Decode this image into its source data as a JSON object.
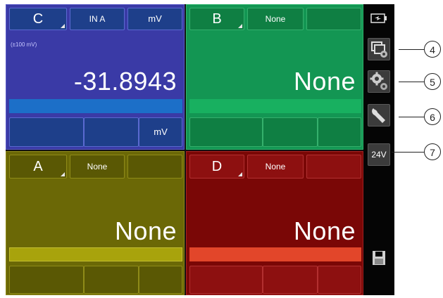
{
  "panels": {
    "C": {
      "channel": "C",
      "function": "IN A",
      "unit": "mV",
      "range": "(±100 mV)",
      "reading": "-31.8943",
      "bottom_unit": "mV",
      "colors": {
        "bg": "#3a3aa6",
        "btn": "#1e3f8a",
        "btn_border": "#5a6ad0",
        "bar": "#1c6fc8"
      }
    },
    "B": {
      "channel": "B",
      "function": "None",
      "reading": "None",
      "colors": {
        "bg": "#139653",
        "btn": "#0f7f43",
        "btn_border": "#35b06c",
        "bar": "#18b060"
      }
    },
    "A": {
      "channel": "A",
      "function": "None",
      "reading": "None",
      "colors": {
        "bg": "#6b6806",
        "btn": "#5a5804",
        "btn_border": "#8f8b18",
        "bar": "#a8a30c"
      }
    },
    "D": {
      "channel": "D",
      "function": "None",
      "reading": "None",
      "colors": {
        "bg": "#7a0706",
        "btn": "#8d1010",
        "btn_border": "#b23030",
        "bar": "#e2462a"
      }
    }
  },
  "sidebar": {
    "battery_icon": "battery-charging-icon",
    "buttons": [
      {
        "icon": "windows-settings-icon"
      },
      {
        "icon": "gears-icon"
      },
      {
        "icon": "wrench-icon"
      },
      {
        "label": "24V"
      }
    ],
    "save_icon": "save-icon"
  },
  "callouts": [
    "4",
    "5",
    "6",
    "7"
  ]
}
